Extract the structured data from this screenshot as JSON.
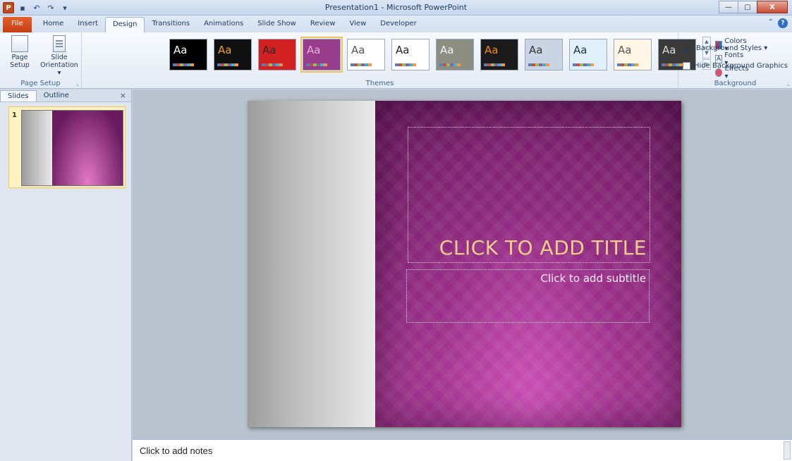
{
  "window": {
    "title": "Presentation1 - Microsoft PowerPoint",
    "controls": {
      "minimize": "—",
      "maximize": "▢",
      "close": "X"
    }
  },
  "qat": {
    "app_icon": "P",
    "save": "▪",
    "undo": "↶",
    "redo": "↷",
    "customize": "▾"
  },
  "tabs": [
    {
      "label": "File"
    },
    {
      "label": "Home"
    },
    {
      "label": "Insert"
    },
    {
      "label": "Design"
    },
    {
      "label": "Transitions"
    },
    {
      "label": "Animations"
    },
    {
      "label": "Slide Show"
    },
    {
      "label": "Review"
    },
    {
      "label": "View"
    },
    {
      "label": "Developer"
    }
  ],
  "active_tab": "Design",
  "ribbon": {
    "page_setup": {
      "group_label": "Page Setup",
      "page_setup_label": "Page Setup",
      "slide_orientation_label": "Slide Orientation ▾"
    },
    "themes": {
      "group_label": "Themes",
      "aa": "Aa",
      "items": [
        {
          "bg": "#000000",
          "fg": "#ffffff"
        },
        {
          "bg": "#101010",
          "fg": "#f2a31d"
        },
        {
          "bg": "#d32020",
          "fg": "#2a2a2a"
        },
        {
          "bg": "#9a3c8c",
          "fg": "#e7b3da"
        },
        {
          "bg": "#ffffff",
          "fg": "#555555"
        },
        {
          "bg": "#ffffff",
          "fg": "#222222"
        },
        {
          "bg": "#8b8e80",
          "fg": "#f5f5f5"
        },
        {
          "bg": "#1b1b1b",
          "fg": "#f08d1c"
        },
        {
          "bg": "#c9d5e5",
          "fg": "#333333"
        },
        {
          "bg": "#dff0fb",
          "fg": "#234"
        },
        {
          "bg": "#fff6e6",
          "fg": "#555555"
        },
        {
          "bg": "#3a3a3a",
          "fg": "#dddddd"
        }
      ],
      "colors_label": "Colors ▾",
      "fonts_label": "Fonts ▾",
      "effects_label": "Effects ▾"
    },
    "background": {
      "group_label": "Background",
      "background_styles_label": "Background Styles ▾",
      "hide_background_graphics_label": "Hide Background Graphics"
    }
  },
  "left_panel": {
    "tabs": [
      {
        "label": "Slides"
      },
      {
        "label": "Outline"
      }
    ],
    "close": "×",
    "slide_number": "1"
  },
  "slide": {
    "title_placeholder": "CLICK TO ADD TITLE",
    "subtitle_placeholder": "Click to add subtitle"
  },
  "notes": {
    "placeholder": "Click to add notes"
  },
  "colors": {
    "accent_file_tab": "#d04a17",
    "slide_purple": "#8c2a7d",
    "title_gold": "#f2cf8a"
  }
}
